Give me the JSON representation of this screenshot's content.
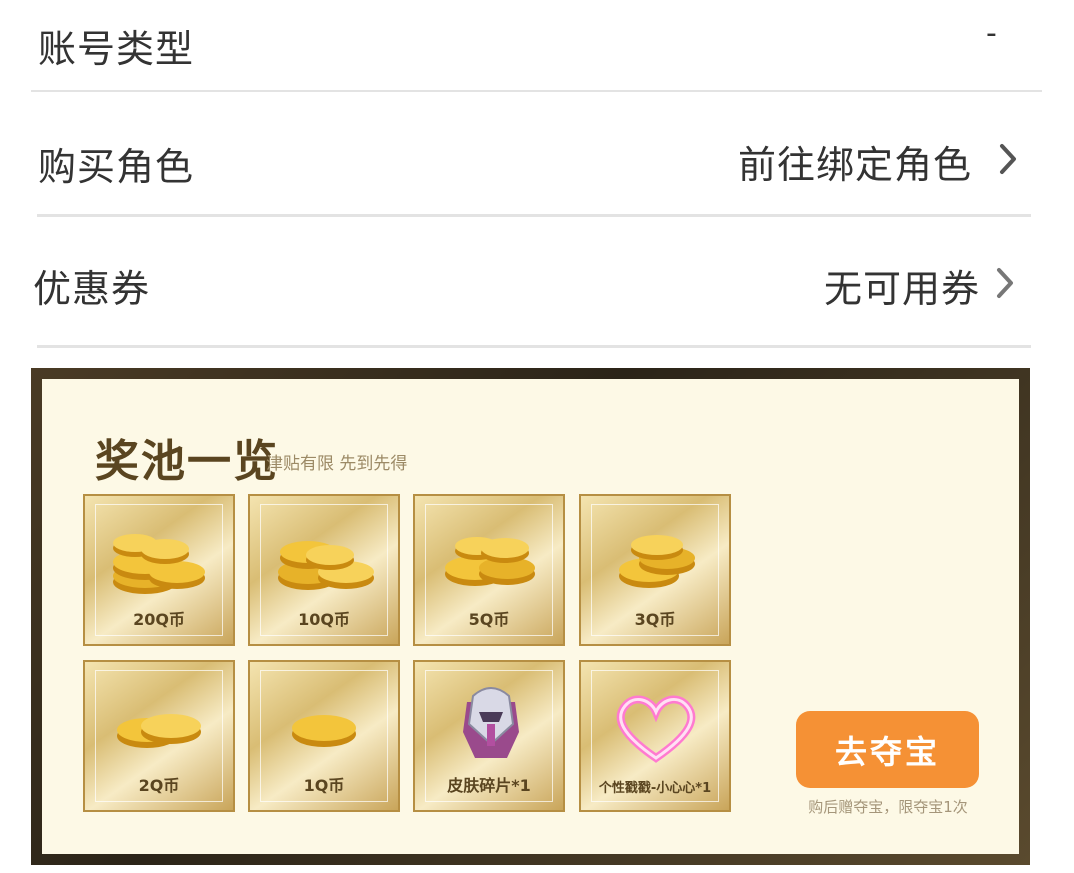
{
  "account_type": {
    "label": "账号类型",
    "value": "-"
  },
  "buy_role": {
    "label": "购买角色",
    "value": "前往绑定角色"
  },
  "coupon": {
    "label": "优惠券",
    "value": "无可用券"
  },
  "prize_pool": {
    "title": "奖池一览",
    "subtitle": "津贴有限 先到先得",
    "items": [
      {
        "label": "20Q币",
        "icon": "coin-stack-icon"
      },
      {
        "label": "10Q币",
        "icon": "coin-stack-icon"
      },
      {
        "label": "5Q币",
        "icon": "coin-stack-icon"
      },
      {
        "label": "3Q币",
        "icon": "coin-stack-icon"
      },
      {
        "label": "2Q币",
        "icon": "coin-pair-icon"
      },
      {
        "label": "1Q币",
        "icon": "coin-icon"
      },
      {
        "label": "皮肤碎片*1",
        "icon": "skin-fragment-icon"
      },
      {
        "label": "个性戳戳-小心心*1",
        "icon": "heart-icon"
      }
    ],
    "action_button": "去夺宝",
    "action_note": "购后赠夺宝，限夺宝1次"
  },
  "colors": {
    "accent": "#f59135",
    "title": "#5a4520",
    "panel_bg": "#fdf9e6"
  }
}
